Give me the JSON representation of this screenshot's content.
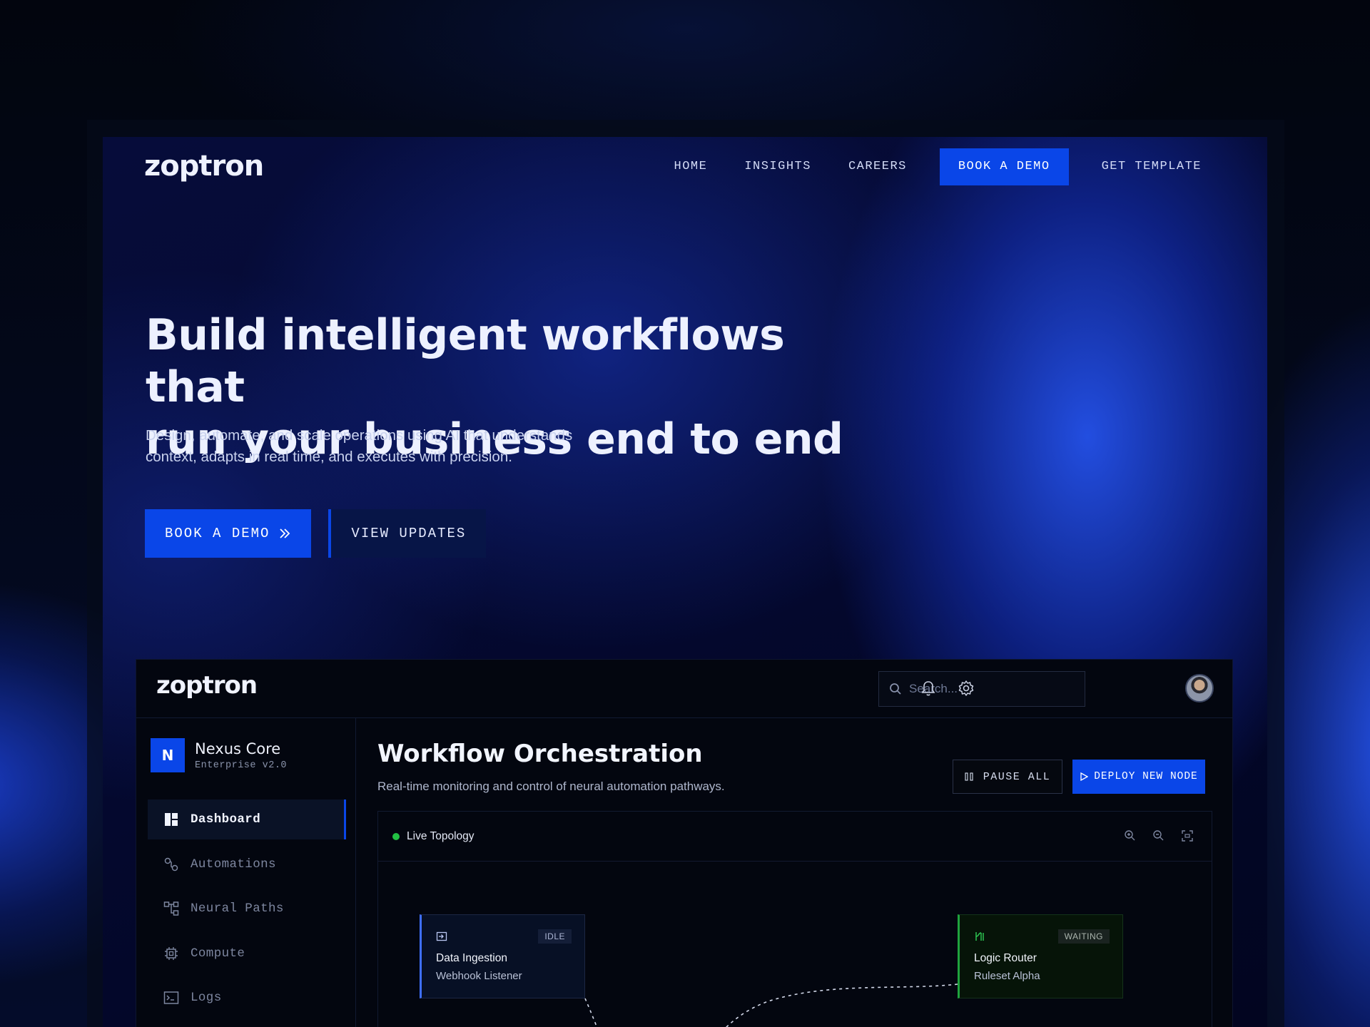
{
  "site": {
    "logo": "zoptron",
    "nav": [
      {
        "label": "HOME"
      },
      {
        "label": "INSIGHTS"
      },
      {
        "label": "CAREERS"
      },
      {
        "label": "BOOK A DEMO"
      },
      {
        "label": "GET TEMPLATE"
      }
    ],
    "hero": {
      "title_line1": "Build intelligent workflows that",
      "title_line2": "run your business end to end",
      "subtitle_line1": "Design, automate, and scale operations using AI that understands",
      "subtitle_line2": "context, adapts in real time, and executes with precision.",
      "primary_button": "BOOK A DEMO",
      "secondary_button": "VIEW UPDATES"
    }
  },
  "app": {
    "logo": "zoptron",
    "search": {
      "placeholder": "Search..."
    },
    "workspace": {
      "badge": "N",
      "name": "Nexus Core",
      "version": "Enterprise v2.0"
    },
    "menu": [
      {
        "label": "Dashboard",
        "icon": "dashboard-icon",
        "active": true
      },
      {
        "label": "Automations",
        "icon": "automations-icon"
      },
      {
        "label": "Neural Paths",
        "icon": "neural-paths-icon"
      },
      {
        "label": "Compute",
        "icon": "cpu-icon"
      },
      {
        "label": "Logs",
        "icon": "terminal-icon"
      }
    ],
    "page": {
      "title": "Workflow Orchestration",
      "subtitle": "Real-time monitoring and control of neural automation pathways.",
      "pause_label": "PAUSE ALL",
      "deploy_label": "DEPLOY NEW NODE"
    },
    "topology": {
      "label": "Live Topology",
      "nodes": [
        {
          "title": "Data Ingestion",
          "subtitle": "Webhook Listener",
          "status": "IDLE"
        },
        {
          "title": "Logic Router",
          "subtitle": "Ruleset Alpha",
          "status": "WAITING"
        }
      ]
    }
  },
  "colors": {
    "accent": "#0a46e8",
    "live": "#22c043",
    "background": "#020611"
  }
}
